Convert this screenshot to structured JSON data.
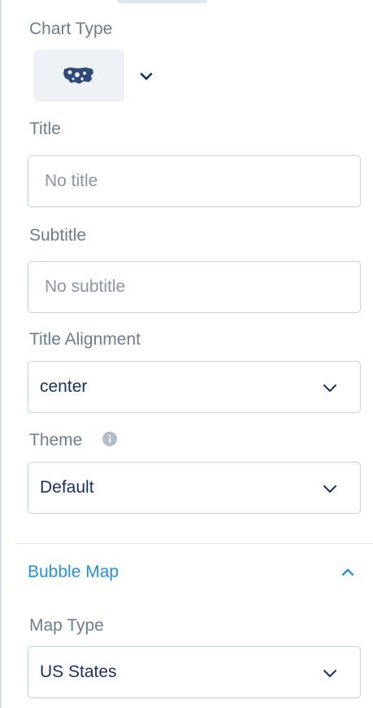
{
  "chart_type": {
    "label": "Chart Type",
    "selected_icon": "us-map-icon"
  },
  "title_field": {
    "label": "Title",
    "placeholder": "No title",
    "value": ""
  },
  "subtitle_field": {
    "label": "Subtitle",
    "placeholder": "No subtitle",
    "value": ""
  },
  "title_alignment": {
    "label": "Title Alignment",
    "value": "center"
  },
  "theme": {
    "label": "Theme",
    "value": "Default",
    "info_icon": "info-icon"
  },
  "bubble_map": {
    "label": "Bubble Map"
  },
  "map_type": {
    "label": "Map Type",
    "value": "US States"
  },
  "colors": {
    "label": "#6b7c93",
    "accent": "#2a8ed6",
    "border": "#c9d0da",
    "value_text": "#16325c",
    "map_icon": "#2e4a7a"
  }
}
